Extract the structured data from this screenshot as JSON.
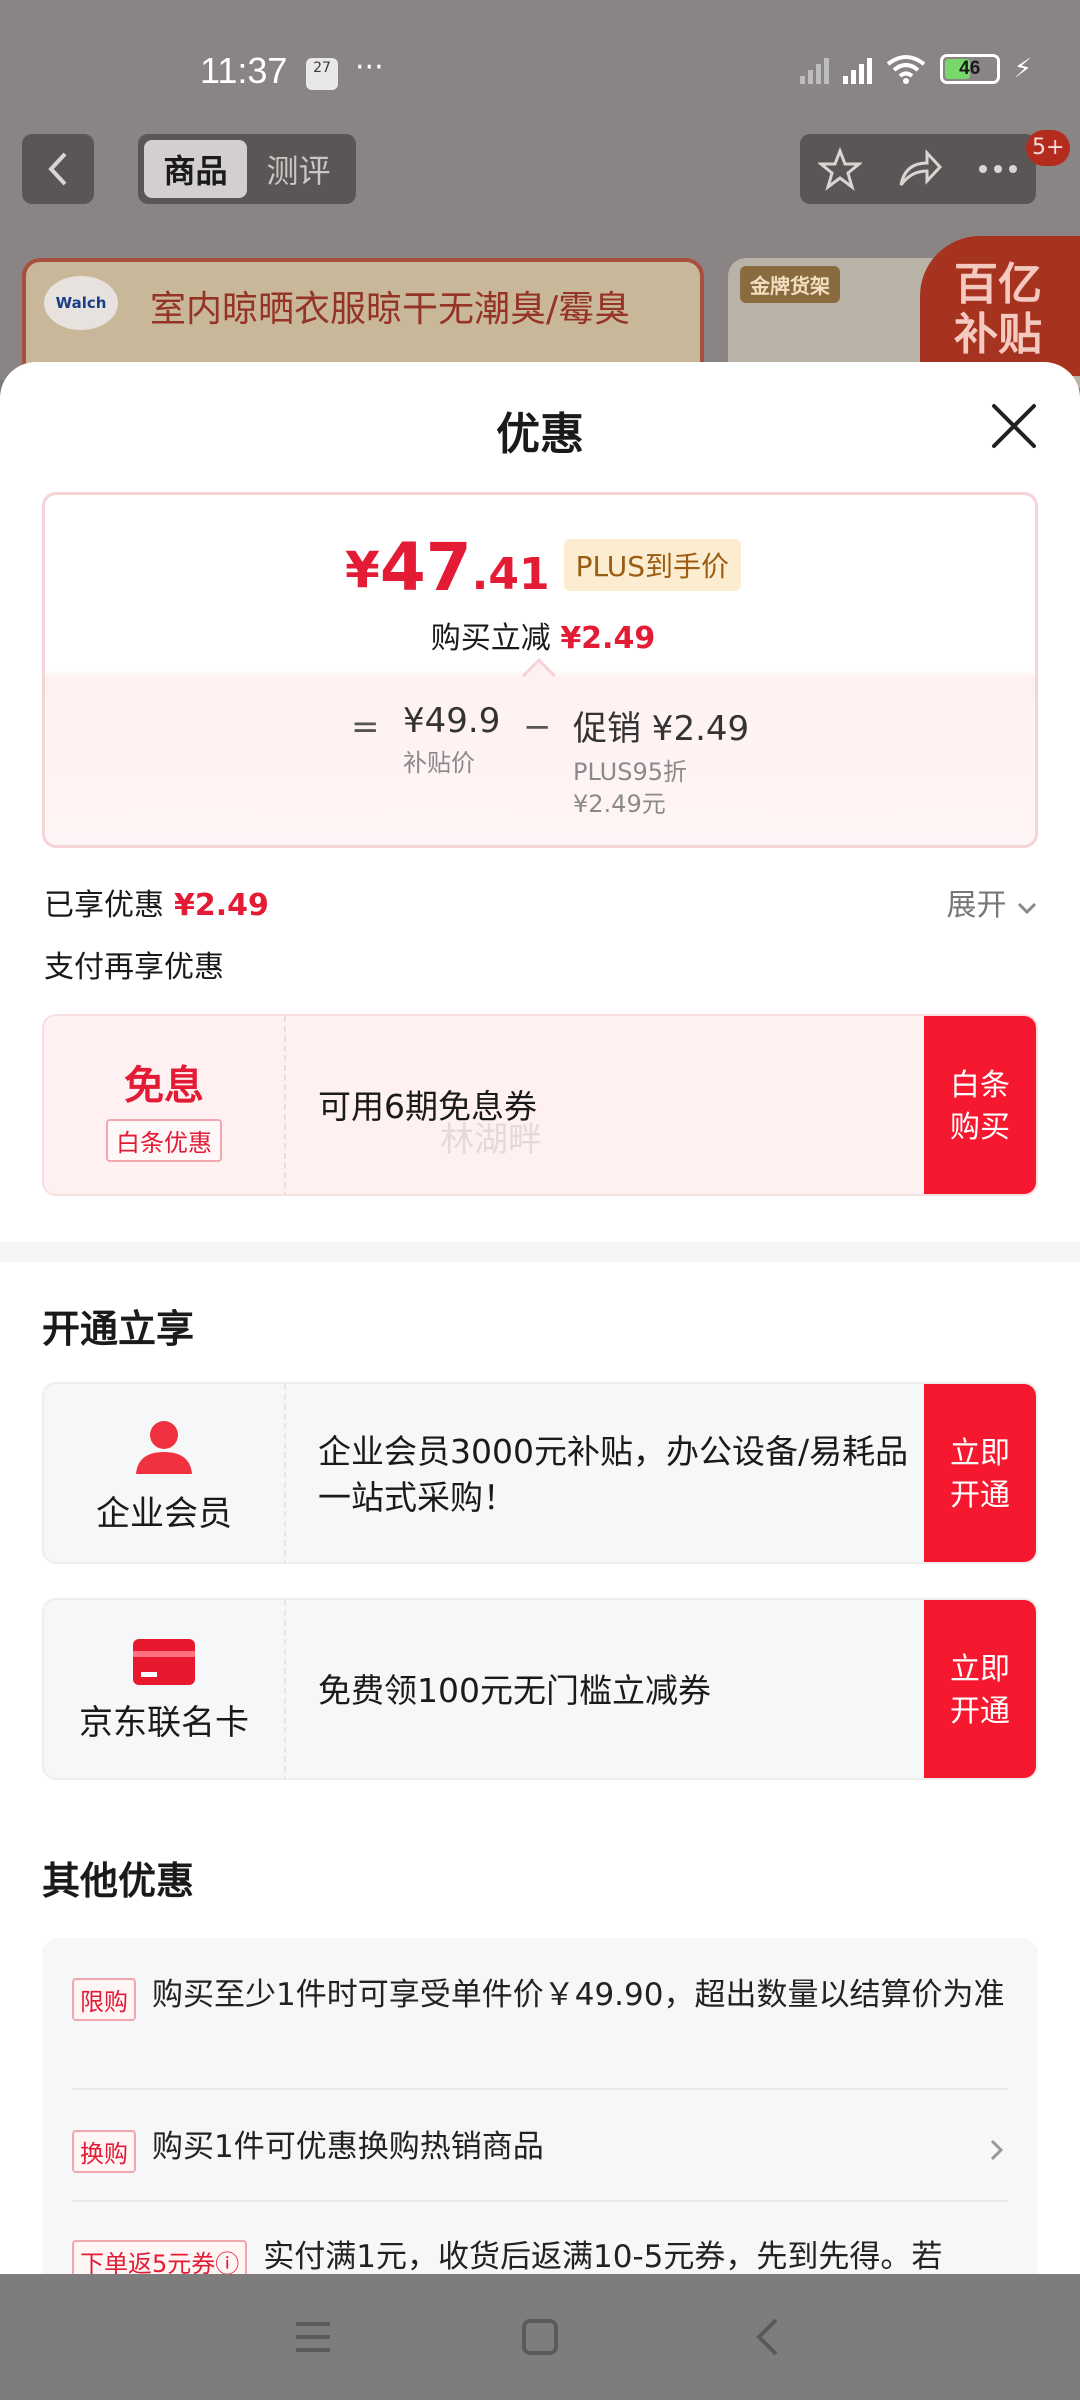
{
  "status_bar": {
    "time": "11:37",
    "calendar_day": "27",
    "more": "···",
    "battery": "46"
  },
  "nav": {
    "tab_product": "商品",
    "tab_review": "测评",
    "badge": "5+"
  },
  "background_banner": {
    "logo": "Walch",
    "text": "室内晾晒衣服晾干无潮臭/霉臭",
    "tag": "金牌货架",
    "subsidy": "百亿补贴"
  },
  "sheet": {
    "title": "优惠",
    "price": {
      "yen": "¥",
      "integer": "47",
      "decimal": ".41",
      "plus_tag": "PLUS到手价"
    },
    "reduce": {
      "label": "购买立减",
      "amount": "¥2.49"
    },
    "formula": {
      "eq": "=",
      "base_price": "¥49.9",
      "base_label": "补贴价",
      "minus": "−",
      "promo_title": "促销 ¥2.49",
      "promo_desc": "PLUS95折",
      "promo_amount": "¥2.49元"
    },
    "enjoyed": {
      "label": "已享优惠",
      "amount": "¥2.49"
    },
    "expand": "展开",
    "pay_more": "支付再享优惠",
    "baitiao": {
      "title": "免息",
      "tag": "白条优惠",
      "text": "可用6期免息券",
      "button": "白条购买",
      "watermark": "林湖畔"
    },
    "open_section": "开通立享",
    "enterprise": {
      "label": "企业会员",
      "text": " 企业会员3000元补贴，办公设备/易耗品一站式采购！",
      "button": "立即开通"
    },
    "jd_card": {
      "label": "京东联名卡",
      "text": "免费领100元无门槛立减券",
      "button": "立即开通"
    },
    "other_section": "其他优惠",
    "other": [
      {
        "tag": "限购",
        "text": "购买至少1件时可享受单件价￥49.90，超出数量以结算价为准"
      },
      {
        "tag": "换购",
        "text": "购买1件可优惠换购热销商品"
      },
      {
        "tag": "下单返5元券ⓘ",
        "text": "实付满1元，收货后返满10-5元券，先到先得。若"
      }
    ]
  },
  "colors": {
    "accent_red": "#e31b35",
    "button_red": "#f5182f",
    "plus_gold": "#9b5c13"
  }
}
